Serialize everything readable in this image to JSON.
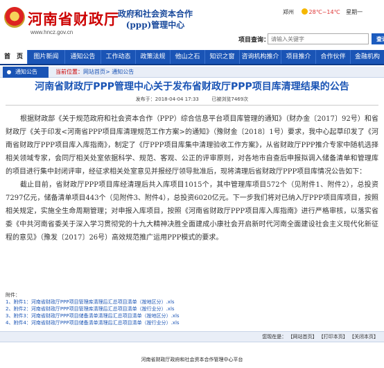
{
  "header": {
    "logo_main": "河南省财政厅",
    "logo_url": "www.hncz.gov.cn",
    "logo_sub_line1": "政府和社会资本合作",
    "logo_sub_line2": "(ppp)管理中心",
    "weather_city": "郑州",
    "weather_temp": "28℃~14℃",
    "weekday": "星期一",
    "date": "请选择",
    "search_label": "项目查询：",
    "search_placeholder": "请输入关键字",
    "search_button": "查询"
  },
  "nav": [
    "首　页",
    "图片新闻",
    "通知公告",
    "工作动态",
    "政策法规",
    "他山之石",
    "知识之窗",
    "咨询机构推介",
    "项目推介",
    "合作伙伴",
    "金融机构"
  ],
  "breadcrumb": {
    "tab": "通知公告",
    "label": "当前位置：",
    "path": "网站首页> 通知公告"
  },
  "article": {
    "title": "河南省财政厅PPP管理中心关于发布省财政厅PPP项目库清理结果的公告",
    "meta_published": "发布于：2018-04-04 17:33",
    "meta_views": "已被浏览7469次",
    "para1": "根据财政部《关于规范政府和社会资本合作（PPP）综合信息平台项目库管理的通知》（财办金〔2017〕92号）和省财政厅《关于印发<河南省PPP项目库清理规范工作方案>的通知》（豫财金〔2018〕1号）要求，我中心起草印发了《河南省财政厅PPP项目库入库指南》，制定了《厅PPP项目库集中清理验收工作方案》，从省财政厅PPP推介专家中随机选择相关领域专家，会同厅相关处室依据科学、规范、客观、公正的评审原则，对各地市自查后申报拟调入储备清单和管理库的项目进行集中封闭评审，经征求相关处室意见并报经厅领导批准后，现将清理后省财政厅PPP项目库情况公告如下：",
    "para2": "截止目前，省财政厅PPP项目库经清理后共入库项目1015个，其中管理库项目572个（见附件1、附件2），总投资7297亿元，储备清单项目443个（见附件3、附件4），总投资6020亿元。下一步我们将对已纳入厅PPP项目库项目，按照相关规定，实施全生命周期管理；对申报入库项目，按照《河南省财政厅PPP项目库入库指南》进行严格审核，以落实省委《中共河南省委关于深入学习贯彻党的十九大精神决胜全面建成小康社会开启新时代河南全面建设社会主义现代化新征程的意见》（豫发〔2017〕26号）高效规范推广运用PPP模式的要求。",
    "attach_label": "附件：",
    "attachments": [
      "1、附件1：河南省财政厅PPP项目管理库清理后汇总项目清单（按地区分）.xls",
      "2、附件2：河南省财政厅PPP项目管理库清理后汇总项目清单（按行业分）.xls",
      "3、附件3：河南省财政厅PPP项目储备清单清理后汇总项目清单（按地区分）.xls",
      "4、附件4：河南省财政厅PPP项目储备清单清理后汇总项目清单（按行业分）.xls"
    ]
  },
  "tools": {
    "prefix": "您现在是：",
    "back": "【网站首页】",
    "print": "【打印本页】",
    "close": "【关闭本页】"
  },
  "footer": "河南省财政厅政府和社会资本合作管理中心平台"
}
